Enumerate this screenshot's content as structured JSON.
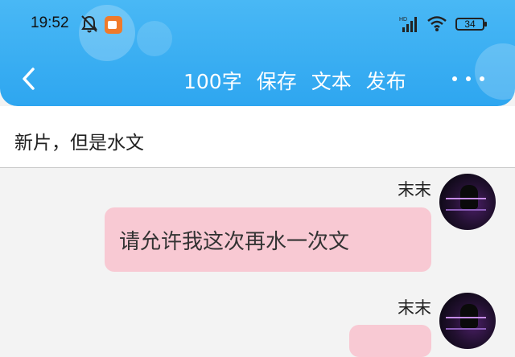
{
  "status_bar": {
    "time": "19:52",
    "battery": "34"
  },
  "header": {
    "actions": {
      "word_count": "100字",
      "save": "保存",
      "text": "文本",
      "publish": "发布"
    }
  },
  "document": {
    "title": "新片，但是水文"
  },
  "messages": [
    {
      "sender": "末末",
      "text": "请允许我这次再水一次文"
    },
    {
      "sender": "末末",
      "text": ""
    }
  ],
  "colors": {
    "header": "#2ea6f0",
    "bubble": "#f8c9d3",
    "record_badge": "#f07a2a"
  }
}
